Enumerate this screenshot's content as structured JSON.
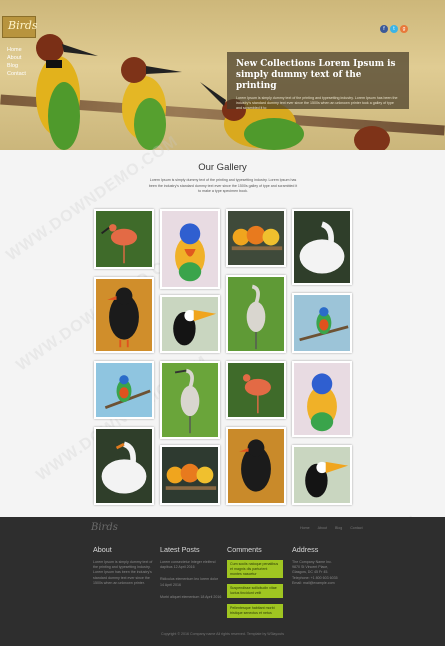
{
  "header": {
    "logo": "Birds",
    "nav": [
      "Home",
      "About",
      "Blog",
      "Contact"
    ],
    "social": [
      "f",
      "t",
      "g"
    ]
  },
  "slider": {
    "title": "New Collections Lorem Ipsum is simply dummy text of the printing",
    "text": "Lorem Ipsum is simply dummy text of the printing and typesetting industry. Lorem Ipsum has been the industry's standard dummy text ever since the 1500s when an unknown printer took a galley of type and scrambled it to"
  },
  "gallery": {
    "title": "Our Gallery",
    "intro": "Lorem Ipsum is simply dummy text of the printing and typesetting industry. Lorem Ipsum has been the industry's standard dummy text ever since the 1500s galley of type and scrambled it to make a type specimen book."
  },
  "footer": {
    "logo": "Birds",
    "links": [
      "Home",
      "About",
      "Blog",
      "Contact"
    ],
    "about": {
      "heading": "About",
      "text": "Lorem Ipsum is simply dummy text of the printing and typesetting industry. Lorem Ipsum has been the industry's standard dummy text ever since the 1500s when an unknown printer."
    },
    "posts": {
      "heading": "Latest Posts",
      "items": [
        "Lorem consectetur Integer eleifend dapibus 12 April 2016",
        "Ridiculus elementum leo lorem dolor 14 April 2016",
        "Morbi aliquet elementum 18 April 2016"
      ]
    },
    "comments": {
      "heading": "Comments",
      "items": [
        "Cum sociis natoque penatibus et magnis dis parturient montes nascetur",
        "Suspendisse sollicitudin vitae luctus tincidunt velit",
        "Pellentesque habitant morbi tristique senectus et netus"
      ]
    },
    "address": {
      "heading": "Address",
      "lines": [
        "The Company Name Inc.",
        "9870 St Vincent Place,",
        "Glasgow, DC 45 Fr 45.",
        "Telephone: +1 800 603 6035",
        "Email: mail@example.com"
      ]
    },
    "copyright": "Copyright © 2016 Company name All rights reserved. Template by W3layouts"
  },
  "watermark": "WWW.DOWNDEMO.COM",
  "colors": {
    "accent": "#9fc521",
    "footer_bg": "#2e2e2e",
    "logo_bg": "#b8943e"
  }
}
